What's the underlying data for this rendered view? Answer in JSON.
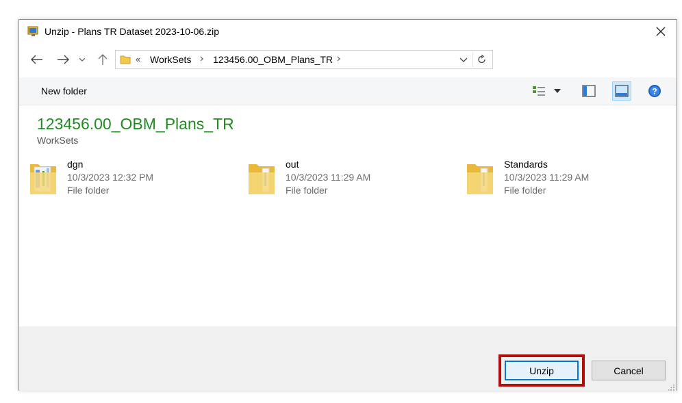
{
  "window": {
    "title": "Unzip - Plans TR  Dataset 2023-10-06.zip"
  },
  "address": {
    "overflow": "«",
    "crumbs": [
      "WorkSets",
      "123456.00_OBM_Plans_TR"
    ]
  },
  "toolbar": {
    "new_folder_label": "New folder"
  },
  "location": {
    "title": "123456.00_OBM_Plans_TR",
    "subtitle": "WorkSets"
  },
  "items": [
    {
      "name": "dgn",
      "date": "10/3/2023 12:32 PM",
      "type": "File folder"
    },
    {
      "name": "out",
      "date": "10/3/2023 11:29 AM",
      "type": "File folder"
    },
    {
      "name": "Standards",
      "date": "10/3/2023 11:29 AM",
      "type": "File folder"
    }
  ],
  "buttons": {
    "unzip_label": "Unzip",
    "cancel_label": "Cancel"
  },
  "colors": {
    "title_green": "#1e8c1e",
    "highlight_red": "#b00d0d",
    "accent_blue": "#0078d7"
  }
}
